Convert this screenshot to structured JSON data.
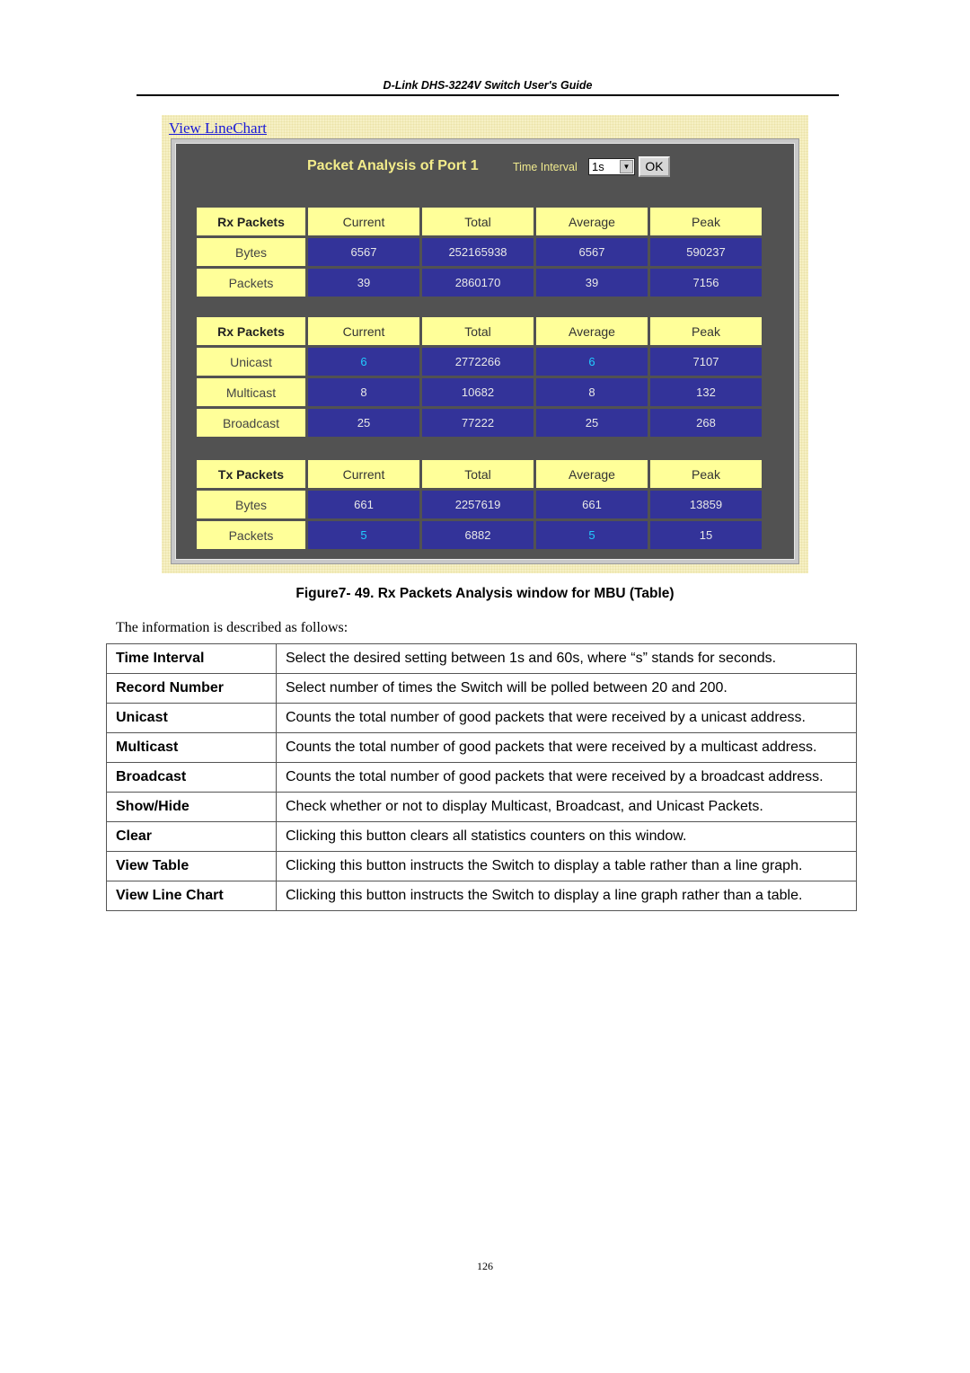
{
  "header": {
    "title": "D-Link DHS-3224V Switch User's Guide"
  },
  "screenshot": {
    "view_link": "View LineChart",
    "panel_title": "Packet Analysis of Port 1",
    "time_interval_label": "Time Interval",
    "time_interval_value": "1s",
    "ok_label": "OK",
    "tables": [
      {
        "headers": [
          "Rx Packets",
          "Current",
          "Total",
          "Average",
          "Peak"
        ],
        "rows": [
          {
            "label": "Bytes",
            "values": [
              "6567",
              "252165938",
              "6567",
              "590237"
            ]
          },
          {
            "label": "Packets",
            "values": [
              "39",
              "2860170",
              "39",
              "7156"
            ]
          }
        ]
      },
      {
        "headers": [
          "Rx Packets",
          "Current",
          "Total",
          "Average",
          "Peak"
        ],
        "rows": [
          {
            "label": "Unicast",
            "values": [
              "6",
              "2772266",
              "6",
              "7107"
            ]
          },
          {
            "label": "Multicast",
            "values": [
              "8",
              "10682",
              "8",
              "132"
            ]
          },
          {
            "label": "Broadcast",
            "values": [
              "25",
              "77222",
              "25",
              "268"
            ]
          }
        ]
      },
      {
        "headers": [
          "Tx Packets",
          "Current",
          "Total",
          "Average",
          "Peak"
        ],
        "rows": [
          {
            "label": "Bytes",
            "values": [
              "661",
              "2257619",
              "661",
              "13859"
            ]
          },
          {
            "label": "Packets",
            "values": [
              "5",
              "6882",
              "5",
              "15"
            ]
          }
        ]
      }
    ],
    "colors": {
      "header_cell": "#ffff99",
      "value_cell": "#333399",
      "highlight_text": "#22ccff",
      "panel_bg": "#525252"
    }
  },
  "caption": "Figure7- 49.  Rx Packets Analysis window for MBU (Table)",
  "intro": "The information is described as follows:",
  "descriptions": [
    {
      "term": "Time Interval",
      "text": "Select the desired setting between 1s and 60s, where “s” stands for seconds."
    },
    {
      "term": "Record Number",
      "text": "Select number of times the Switch will be polled between 20 and 200."
    },
    {
      "term": "Unicast",
      "text": "Counts the total number of good packets that were received by a unicast address."
    },
    {
      "term": "Multicast",
      "text": "Counts the total number of good packets that were received by a multicast address."
    },
    {
      "term": "Broadcast",
      "text": "Counts the total number of good packets that were received by a broadcast address."
    },
    {
      "term": "Show/Hide",
      "text": "Check whether or not to display Multicast, Broadcast, and Unicast Packets."
    },
    {
      "term": "Clear",
      "text": "Clicking this button clears all statistics counters on this window."
    },
    {
      "term": "View Table",
      "text": "Clicking this button instructs the Switch to display a table rather than a line graph."
    },
    {
      "term": "View Line Chart",
      "text": "Clicking this button instructs the Switch to display a line graph rather than a table."
    }
  ],
  "page_number": "126"
}
